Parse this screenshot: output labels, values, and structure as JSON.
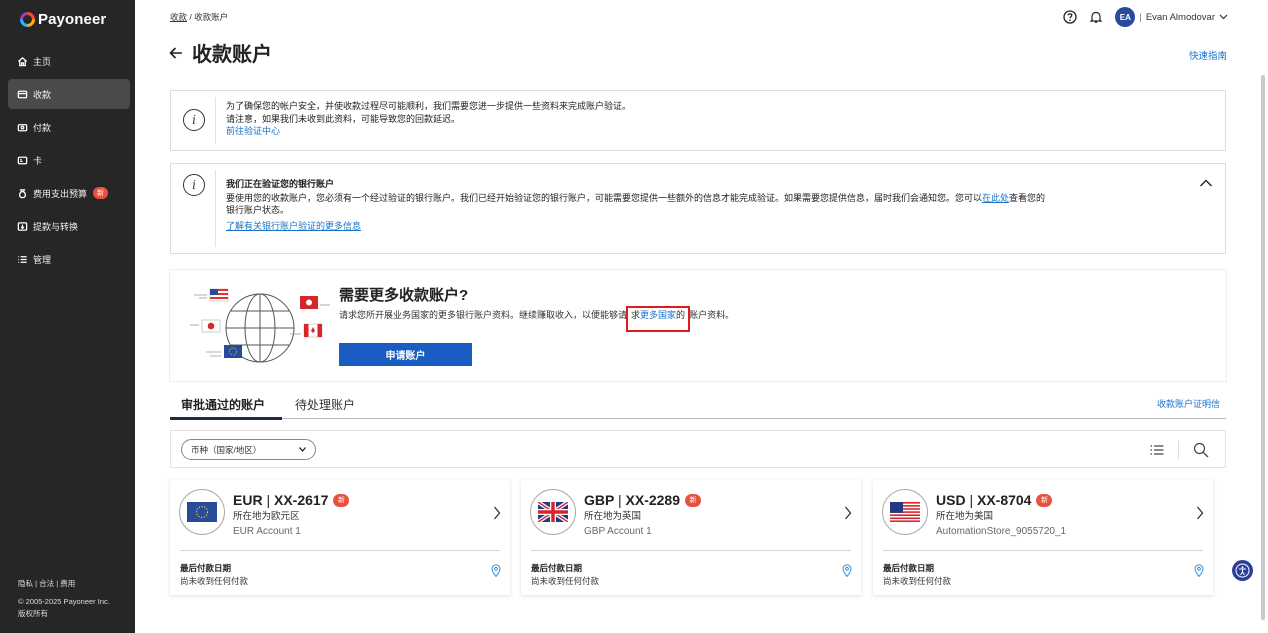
{
  "brand": {
    "name": "Payoneer"
  },
  "sidebar": {
    "items": [
      {
        "label": "主页",
        "icon": "home-icon"
      },
      {
        "label": "收款",
        "icon": "receive-icon"
      },
      {
        "label": "付款",
        "icon": "payment-icon"
      },
      {
        "label": "卡",
        "icon": "card-icon"
      },
      {
        "label": "费用支出预算",
        "icon": "budget-icon",
        "badge": "新"
      },
      {
        "label": "提款与转换",
        "icon": "withdraw-icon"
      },
      {
        "label": "管理",
        "icon": "list-icon"
      }
    ],
    "active_index": 1,
    "footer": {
      "privacy": "隐私",
      "legal": "合法",
      "fees": "费用",
      "sep": "|",
      "copyright": "© 2005-2025 Payoneer Inc.",
      "rights": "版权所有"
    }
  },
  "breadcrumb": {
    "parent": "收款",
    "sep": "/",
    "current": "收款账户"
  },
  "header": {
    "user_name": "Evan Almodovar",
    "avatar_initials": "EA",
    "sep": "|",
    "help_icon": "help-icon",
    "bell_icon": "bell-icon"
  },
  "page": {
    "title": "收款账户",
    "quick_guide": "快速指南"
  },
  "notice_verify": {
    "line1": "为了确保您的帐户安全，并使收款过程尽可能顺利，我们需要您进一步提供一些资料来完成账户验证。",
    "line2": "请注意，如果我们未收到此资料，可能导致您的回款延迟。",
    "link": "前往验证中心"
  },
  "notice_bank": {
    "title": "我们正在验证您的银行账户",
    "body_pre": "要使用您的收款账户，您必须有一个经过验证的银行账户。我们已经开始验证您的银行账户，可能需要您提供一些额外的信息才能完成验证。如果需要您提供信息，届时我们会通知您。您可以",
    "body_link": "在此处",
    "body_post": "查看您的",
    "body_line2": "银行账户状态。",
    "more_link": "了解有关银行账户验证的更多信息"
  },
  "promo": {
    "title": "需要更多收款账户?",
    "desc_pre": "请求您所开展业务国家的更多银行账户资料。继续赚取收入，以便能够请",
    "desc_pre2": "求",
    "desc_link": "更多国家",
    "desc_post1": "的",
    "desc_post": "账户资料。",
    "button": "申请账户"
  },
  "tabs": [
    {
      "label": "审批通过的账户"
    },
    {
      "label": "待处理账户"
    }
  ],
  "certificate_link": "收款账户证明信",
  "filter": {
    "select_value": "币种（国家/地区）"
  },
  "accounts": [
    {
      "currency": "EUR",
      "sep": "|",
      "number": "XX-2617",
      "badge": "新",
      "location": "所在地为欧元区",
      "name": "EUR Account 1",
      "last_label": "最后付款日期",
      "last_value": "尚未收到任何付款",
      "flag": "eu-flag-icon"
    },
    {
      "currency": "GBP",
      "sep": "|",
      "number": "XX-2289",
      "badge": "新",
      "location": "所在地为英国",
      "name": "GBP Account 1",
      "last_label": "最后付款日期",
      "last_value": "尚未收到任何付款",
      "flag": "uk-flag-icon"
    },
    {
      "currency": "USD",
      "sep": "|",
      "number": "XX-8704",
      "badge": "新",
      "location": "所在地为美国",
      "name": "AutomationStore_9055720_1",
      "last_label": "最后付款日期",
      "last_value": "尚未收到任何付款",
      "flag": "us-flag-icon"
    }
  ],
  "colors": {
    "sidebar_bg": "#262626",
    "accent_blue": "#1a5dc2",
    "link_blue": "#1a73c9",
    "badge_red": "#e8523c",
    "highlight_red": "#e01b1b"
  }
}
